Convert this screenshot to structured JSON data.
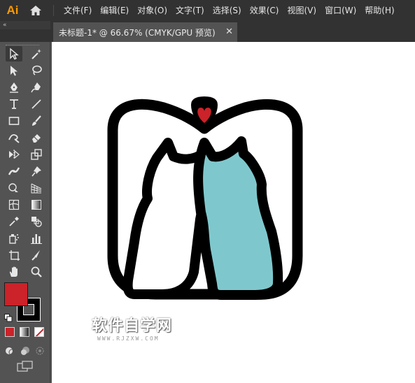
{
  "app": {
    "logo_text": "Ai"
  },
  "menu": [
    "文件(F)",
    "编辑(E)",
    "对象(O)",
    "文字(T)",
    "选择(S)",
    "效果(C)",
    "视图(V)",
    "窗口(W)",
    "帮助(H)"
  ],
  "tabbar": {
    "collapse_icon": "«"
  },
  "document_tab": {
    "label": "未标题-1* @ 66.67% (CMYK/GPU 预览)",
    "close": "✕"
  },
  "tools": [
    "selection-tool",
    "magic-wand-tool",
    "direct-selection-tool",
    "lasso-tool",
    "pen-tool",
    "curvature-tool",
    "type-tool",
    "line-segment-tool",
    "rectangle-tool",
    "paintbrush-tool",
    "shaper-tool",
    "eraser-tool",
    "rotate-tool",
    "scale-tool",
    "width-tool",
    "puppet-warp-tool",
    "shape-builder-tool",
    "perspective-grid-tool",
    "mesh-tool",
    "gradient-tool",
    "eyedropper-tool",
    "blend-tool",
    "symbol-sprayer-tool",
    "column-graph-tool",
    "artboard-tool",
    "slice-tool",
    "hand-tool",
    "zoom-tool"
  ],
  "colors": {
    "fill": "#cc2229",
    "stroke": "#000000",
    "cat_right": "#7ec8cd",
    "heart": "#cc2229"
  },
  "watermark": {
    "main": "软件自学网",
    "sub": "WWW.RJZXW.COM"
  }
}
